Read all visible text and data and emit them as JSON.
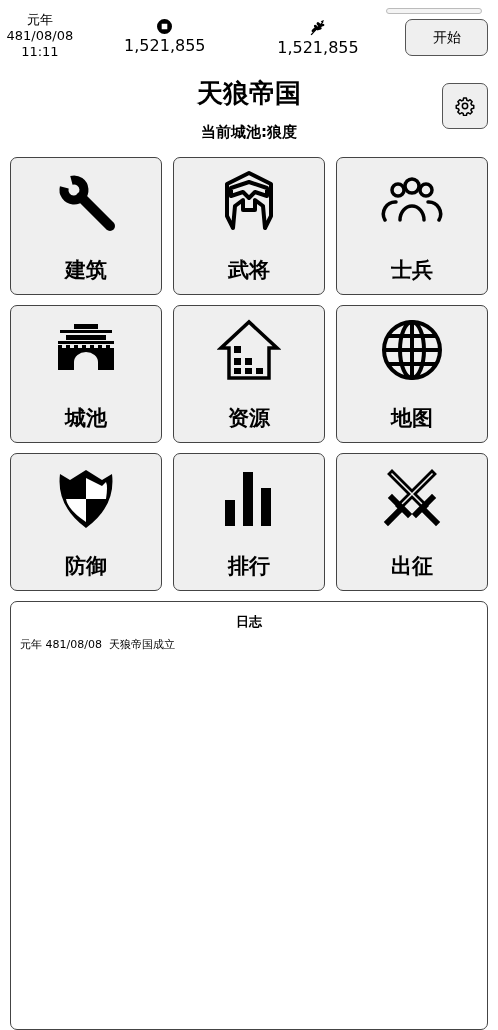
{
  "clock": {
    "era": "元年",
    "date": "481/08/08",
    "time": "11:11"
  },
  "resources": [
    {
      "kind": "coin",
      "value": "1,521,855"
    },
    {
      "kind": "grain",
      "value": "1,521,855"
    }
  ],
  "start_button": "开始",
  "title": "天狼帝国",
  "current_city": "当前城池:狼度",
  "menu": [
    {
      "kind": "wrench",
      "label": "建筑"
    },
    {
      "kind": "helmet",
      "label": "武将"
    },
    {
      "kind": "people",
      "label": "士兵"
    },
    {
      "kind": "gate",
      "label": "城池"
    },
    {
      "kind": "house",
      "label": "资源"
    },
    {
      "kind": "globe",
      "label": "地图"
    },
    {
      "kind": "shield",
      "label": "防御"
    },
    {
      "kind": "bars",
      "label": "排行"
    },
    {
      "kind": "swords",
      "label": "出征"
    }
  ],
  "log": {
    "title": "日志",
    "entries": [
      "元年 481/08/08  天狼帝国成立"
    ]
  }
}
